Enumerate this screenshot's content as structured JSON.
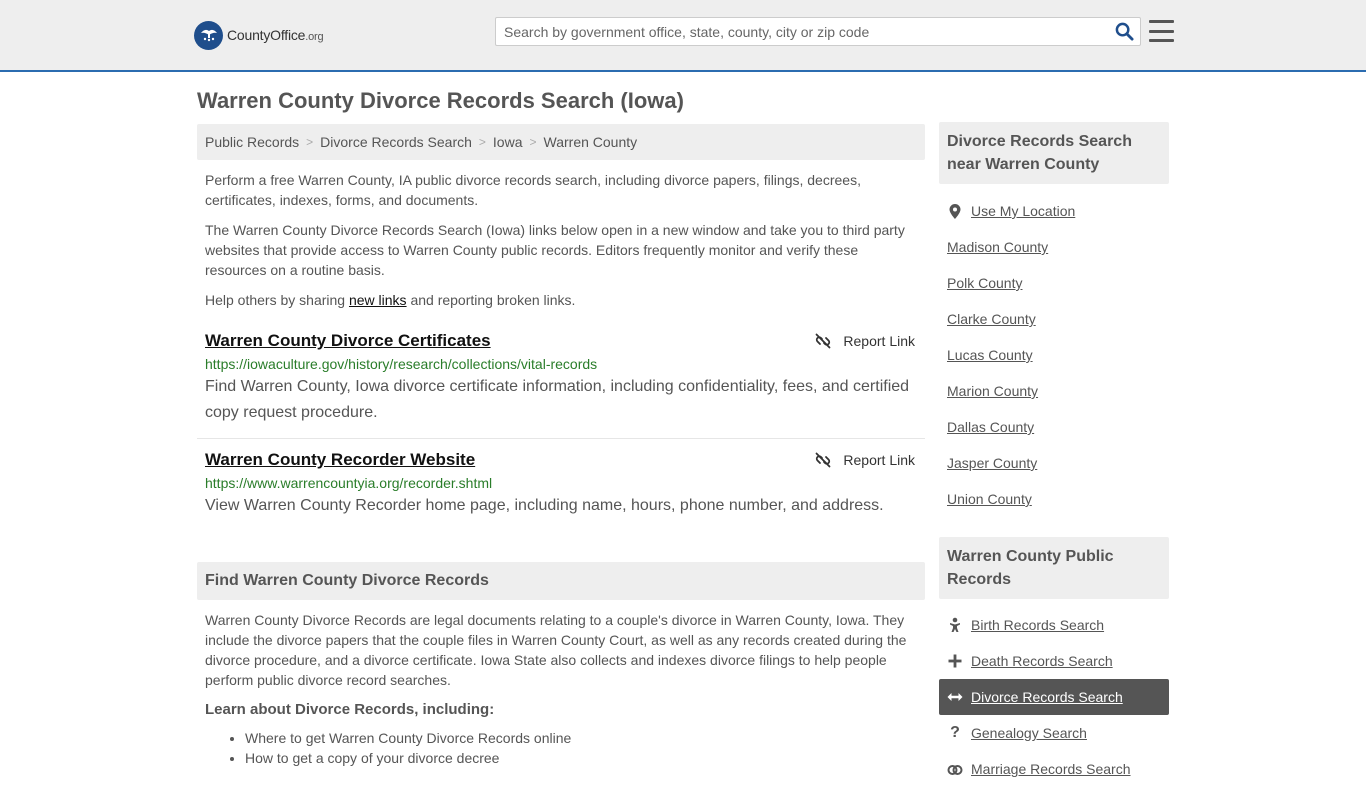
{
  "header": {
    "logo_text_main": "CountyOffice",
    "logo_text_org": ".org",
    "search_placeholder": "Search by government office, state, county, city or zip code"
  },
  "page_title": "Warren County Divorce Records Search (Iowa)",
  "breadcrumb": [
    "Public Records",
    "Divorce Records Search",
    "Iowa",
    "Warren County"
  ],
  "intro": {
    "p1": "Perform a free Warren County, IA public divorce records search, including divorce papers, filings, decrees, certificates, indexes, forms, and documents.",
    "p2": "The Warren County Divorce Records Search (Iowa) links below open in a new window and take you to third party websites that provide access to Warren County public records. Editors frequently monitor and verify these resources on a routine basis.",
    "p3_before": "Help others by sharing ",
    "p3_link": "new links",
    "p3_after": " and reporting broken links."
  },
  "results": [
    {
      "title": "Warren County Divorce Certificates",
      "url": "https://iowaculture.gov/history/research/collections/vital-records",
      "desc": "Find Warren County, Iowa divorce certificate information, including confidentiality, fees, and certified copy request procedure.",
      "report": "Report Link"
    },
    {
      "title": "Warren County Recorder Website",
      "url": "https://www.warrencountyia.org/recorder.shtml",
      "desc": "View Warren County Recorder home page, including name, hours, phone number, and address.",
      "report": "Report Link"
    }
  ],
  "find_section": {
    "heading": "Find Warren County Divorce Records",
    "body": "Warren County Divorce Records are legal documents relating to a couple's divorce in Warren County, Iowa. They include the divorce papers that the couple files in Warren County Court, as well as any records created during the divorce procedure, and a divorce certificate. Iowa State also collects and indexes divorce filings to help people perform public divorce record searches.",
    "learn_heading": "Learn about Divorce Records, including:",
    "learn_items": [
      "Where to get Warren County Divorce Records online",
      "How to get a copy of your divorce decree"
    ]
  },
  "sidebar": {
    "nearby_heading": "Divorce Records Search near Warren County",
    "use_location": "Use My Location",
    "nearby": [
      "Madison County",
      "Polk County",
      "Clarke County",
      "Lucas County",
      "Marion County",
      "Dallas County",
      "Jasper County",
      "Union County"
    ],
    "public_heading": "Warren County Public Records",
    "public_records": [
      {
        "label": "Birth Records Search",
        "icon": "baby-icon",
        "active": false
      },
      {
        "label": "Death Records Search",
        "icon": "plus-icon",
        "active": false
      },
      {
        "label": "Divorce Records Search",
        "icon": "arrows-horizontal-icon",
        "active": true
      },
      {
        "label": "Genealogy Search",
        "icon": "question-icon",
        "active": false
      },
      {
        "label": "Marriage Records Search",
        "icon": "rings-icon",
        "active": false
      }
    ]
  },
  "colors": {
    "accent_border": "#2b6cb0",
    "url_green": "#2a7d2a",
    "active_bg": "#555555"
  }
}
